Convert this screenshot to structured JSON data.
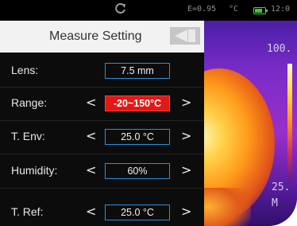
{
  "status": {
    "emissivity": "E=0.95",
    "unit": "°C",
    "time": "12:0"
  },
  "menu": {
    "title": "Measure Setting",
    "rows": [
      {
        "label": "Lens:",
        "value": "7.5 mm",
        "has_arrows": false,
        "selected": false
      },
      {
        "label": "Range:",
        "value": "-20~150°C",
        "has_arrows": true,
        "selected": true
      },
      {
        "label": "T. Env:",
        "value": "25.0 °C",
        "has_arrows": true,
        "selected": false
      },
      {
        "label": "Humidity:",
        "value": "60%",
        "has_arrows": true,
        "selected": false
      },
      {
        "label": "T. Ref:",
        "value": "25.0 °C",
        "has_arrows": true,
        "selected": false
      }
    ],
    "prev_arrow": "<",
    "next_arrow": ">"
  },
  "thermal": {
    "scale_max": "100.",
    "scale_min": "25.",
    "mode_label": "M"
  },
  "colors": {
    "selected": "#e11818",
    "box_border": "#2f8fd6",
    "battery": "#3ac43a"
  }
}
